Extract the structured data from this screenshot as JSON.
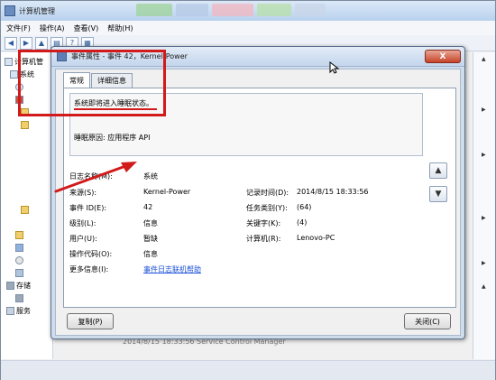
{
  "main_window": {
    "title": "计算机管理",
    "menu": [
      "文件(F)",
      "操作(A)",
      "查看(V)",
      "帮助(H)"
    ],
    "tree_items": [
      {
        "label": "计算机管",
        "icon": "computer-icon"
      },
      {
        "label": "系统",
        "icon": "tools-icon"
      },
      {
        "label": "",
        "icon": "clock-icon"
      },
      {
        "label": "",
        "icon": "event-viewer-icon"
      },
      {
        "label": "",
        "icon": "folder-icon"
      },
      {
        "label": "",
        "icon": "folder-icon"
      },
      {
        "label": "存储",
        "icon": "storage-icon"
      },
      {
        "label": "服务",
        "icon": "services-icon"
      }
    ],
    "bottom_ghost_text": "2014/8/15 18:33:56          Service Control Manager"
  },
  "dialog": {
    "title": "事件属性 - 事件 42，Kernel-Power",
    "close_label": "X",
    "tabs": [
      {
        "label": "常规",
        "active": true
      },
      {
        "label": "详细信息",
        "active": false
      }
    ],
    "description": {
      "line1": "系统即将进入睡眠状态。",
      "line2": "睡眠原因: 应用程序 API"
    },
    "fields": {
      "log_name": {
        "label": "日志名称(M):",
        "value": "系统"
      },
      "source": {
        "label": "来源(S):",
        "value": "Kernel-Power"
      },
      "event_id": {
        "label": "事件 ID(E):",
        "value": "42"
      },
      "level": {
        "label": "级别(L):",
        "value": "信息"
      },
      "user": {
        "label": "用户(U):",
        "value": "暂缺"
      },
      "opcode": {
        "label": "操作代码(O):",
        "value": "信息"
      },
      "more_info": {
        "label": "更多信息(I):",
        "value": "事件日志联机帮助"
      },
      "logged": {
        "label": "记录时间(D):",
        "value": "2014/8/15 18:33:56"
      },
      "task_category": {
        "label": "任务类别(Y):",
        "value": "(64)"
      },
      "keywords": {
        "label": "关键字(K):",
        "value": "(4)"
      },
      "computer": {
        "label": "计算机(R):",
        "value": "Lenovo-PC"
      }
    },
    "buttons": {
      "copy": "复制(P)",
      "close": "关闭(C)"
    }
  },
  "colors": {
    "annotation_red": "#d21a1a",
    "link_blue": "#1a4fd6",
    "dialog_frame": "#cfdcec"
  }
}
